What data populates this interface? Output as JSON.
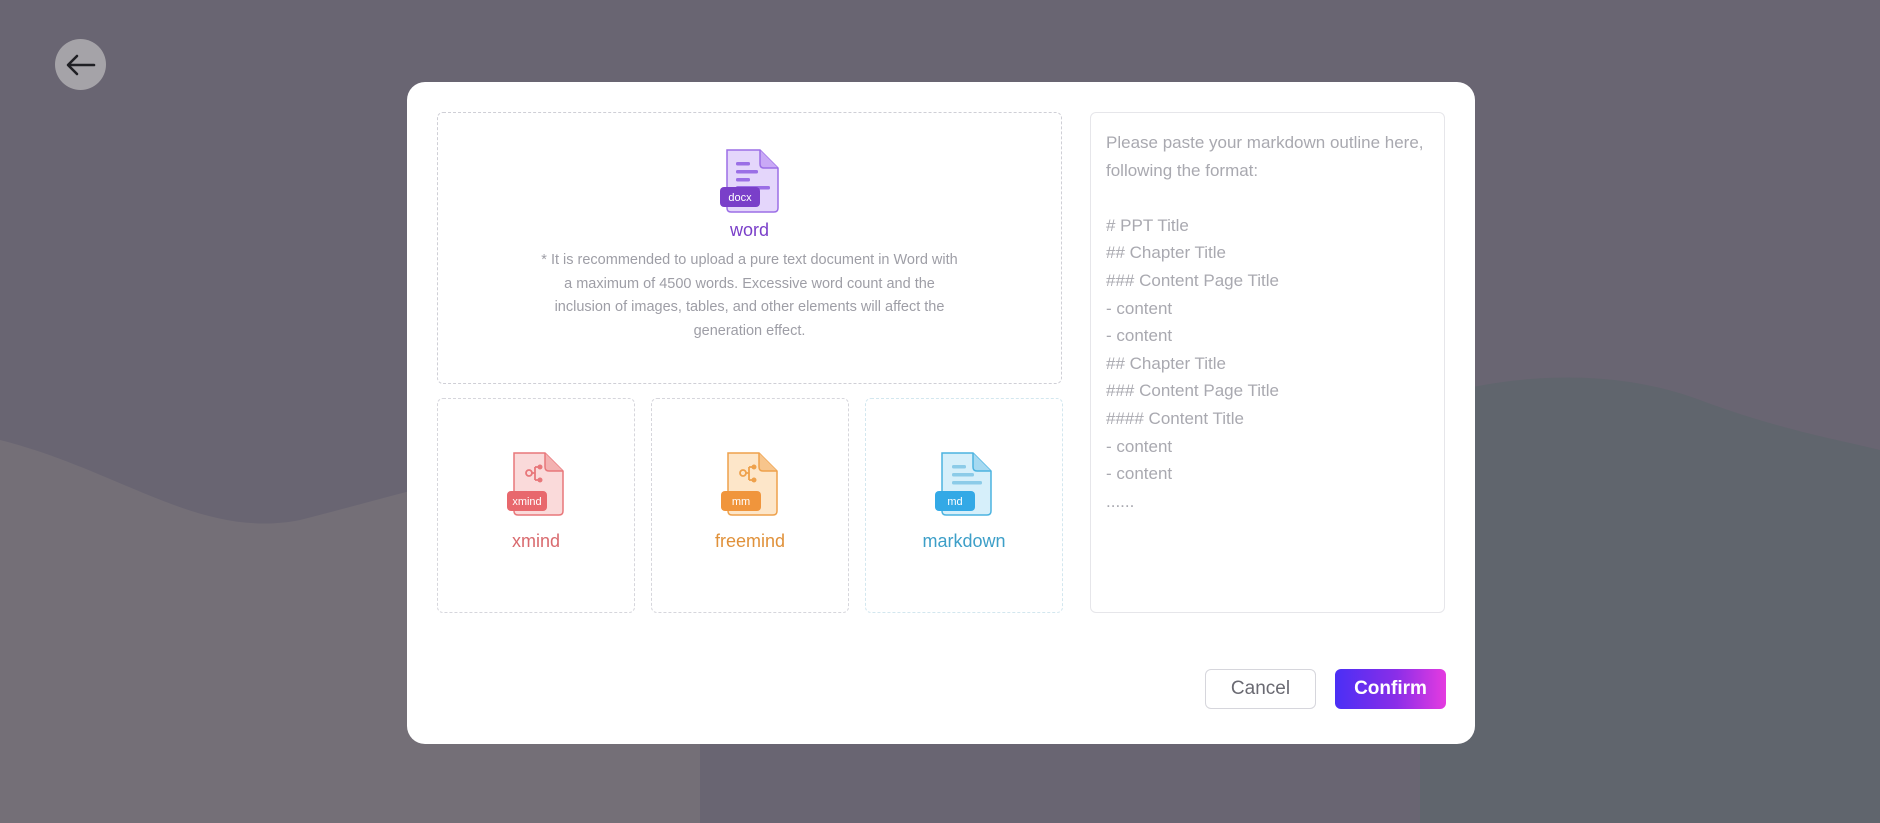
{
  "back_button": {
    "icon": "arrow-left-icon"
  },
  "modal": {
    "word_card": {
      "label": "word",
      "badge": "docx",
      "hint": "* It is recommended to upload a pure text document in Word with a maximum of 4500 words. Excessive word count and the inclusion of images, tables, and other elements will affect the generation effect.",
      "color": "#7a3fc9"
    },
    "cards": [
      {
        "label": "xmind",
        "badge": "xmind",
        "color": "#d96a6e"
      },
      {
        "label": "freemind",
        "badge": "mm",
        "color": "#e0913a"
      },
      {
        "label": "markdown",
        "badge": "md",
        "color": "#3d9fc8"
      }
    ],
    "outline": {
      "placeholder": "Please paste your markdown outline here, following the format:\n\n# PPT Title\n## Chapter Title\n### Content Page Title\n- content\n- content\n## Chapter Title\n### Content Page Title\n#### Content Title\n- content\n- content\n......",
      "value": ""
    },
    "footer": {
      "cancel_label": "Cancel",
      "confirm_label": "Confirm"
    }
  }
}
